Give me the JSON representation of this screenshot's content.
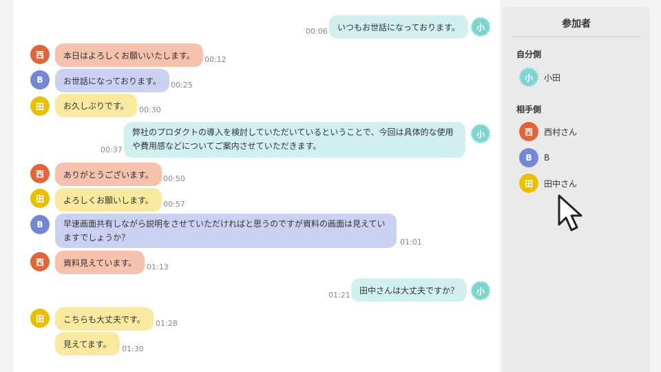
{
  "chat": {
    "messages": [
      {
        "sender": "小",
        "side": "self",
        "text": "いつもお世話になっております。",
        "time": "00:06"
      },
      {
        "sender": "西",
        "side": "other",
        "text": "本日はよろしくお願いいたします。",
        "time": "00:12"
      },
      {
        "sender": "B",
        "side": "other",
        "text": "お世話になっております。",
        "time": "00:25"
      },
      {
        "sender": "田",
        "side": "other",
        "text": "お久しぶりです。",
        "time": "00:30"
      },
      {
        "sender": "小",
        "side": "self",
        "text": "弊社のプロダクトの導入を検討していただいているということで、今回は具体的な使用や費用感などについてご案内させていただきます。",
        "time": "00:37"
      },
      {
        "sender": "西",
        "side": "other",
        "text": "ありがとうございます。",
        "time": "00:50"
      },
      {
        "sender": "田",
        "side": "other",
        "text": "よろしくお願いします。",
        "time": "00:57"
      },
      {
        "sender": "B",
        "side": "other",
        "text": "早速画面共有しながら説明をさせていただければと思うのですが資料の画面は見えていますでしょうか？",
        "time": "01:01"
      },
      {
        "sender": "西",
        "side": "other",
        "text": "資料見えています。",
        "time": "01:13"
      },
      {
        "sender": "小",
        "side": "self",
        "text": "田中さんは大丈夫ですか？",
        "time": "01:21"
      },
      {
        "sender": "田",
        "side": "other",
        "text": "こちらも大丈夫です。",
        "time": "01:28"
      },
      {
        "sender": "",
        "side": "other",
        "text": "見えてます。",
        "time": "01:30"
      }
    ]
  },
  "sidebar": {
    "title": "参加者",
    "own_heading": "自分側",
    "other_heading": "相手側",
    "own": [
      {
        "initial": "小",
        "name": "小田"
      }
    ],
    "others": [
      {
        "initial": "西",
        "name": "西村さん"
      },
      {
        "initial": "B",
        "name": "B"
      },
      {
        "initial": "田",
        "name": "田中さん"
      }
    ]
  },
  "colors": {
    "nishi": "#e0663a",
    "b": "#7288d4",
    "tanaka": "#e8c000",
    "self": "#7fd3cf",
    "bubble_nishi": "#f6c2ad",
    "bubble_b": "#cbd1f0",
    "bubble_tanaka": "#faeaa0",
    "bubble_self": "#d1f0ef"
  },
  "icons": {
    "cursor": "mouse-pointer-icon"
  }
}
